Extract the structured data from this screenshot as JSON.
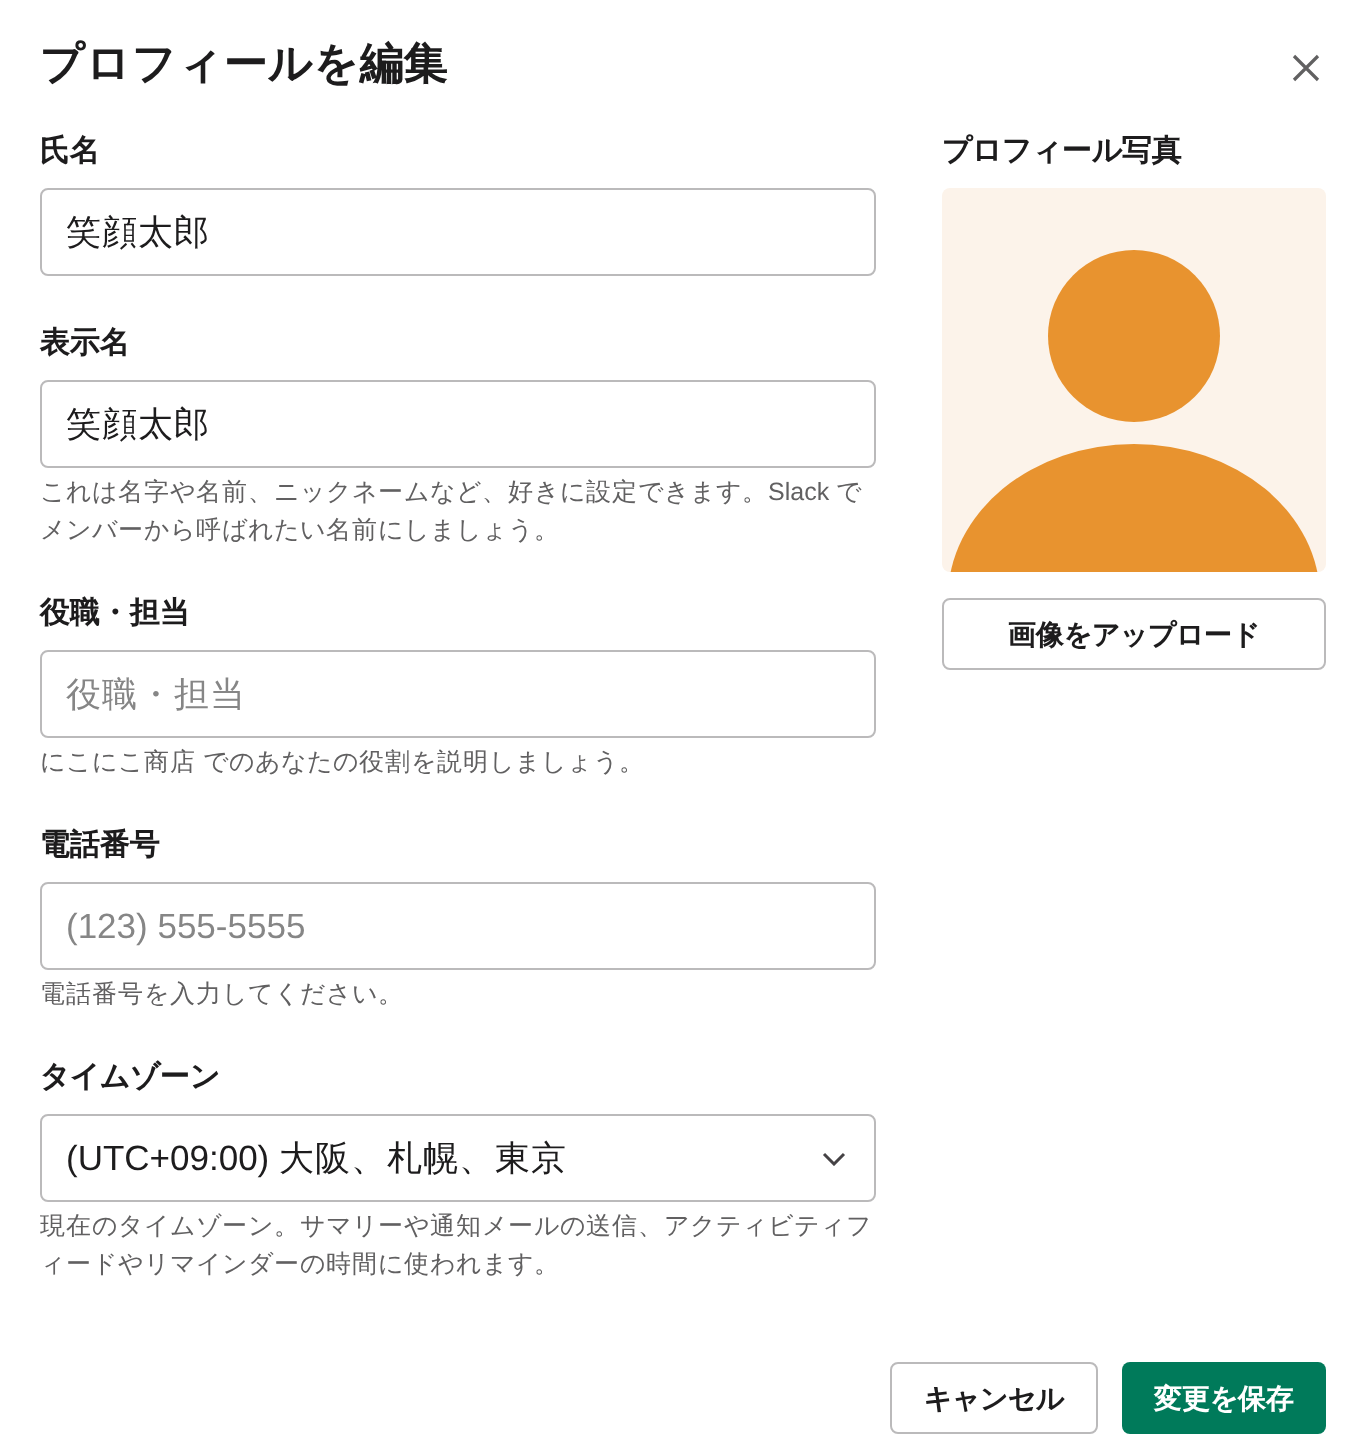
{
  "dialog": {
    "title": "プロフィールを編集"
  },
  "fields": [
    {
      "kind": "text",
      "label": "氏名",
      "value": "笑顔太郎"
    },
    {
      "kind": "text",
      "label": "表示名",
      "value": "笑顔太郎",
      "hint": "これは名字や名前、ニックネームなど、好きに設定できます。Slack でメンバーから呼ばれたい名前にしましょう。"
    },
    {
      "kind": "text",
      "label": "役職・担当",
      "placeholder": "役職・担当",
      "hint": "にこにこ商店 でのあなたの役割を説明しましょう。"
    },
    {
      "kind": "text",
      "label": "電話番号",
      "placeholder": "(123) 555-5555",
      "hint": "電話番号を入力してください。"
    },
    {
      "kind": "select",
      "label": "タイムゾーン",
      "value": "(UTC+09:00) 大阪、札幌、東京",
      "hint": "現在のタイムゾーン。サマリーや通知メールの送信、アクティビティフィードやリマインダーの時間に使われます。"
    }
  ],
  "photo": {
    "label": "プロフィール写真",
    "button": "画像をアップロード"
  },
  "buttons": [
    {
      "kind": "secondary",
      "label": "キャンセル"
    },
    {
      "kind": "primary",
      "label": "変更を保存"
    }
  ]
}
